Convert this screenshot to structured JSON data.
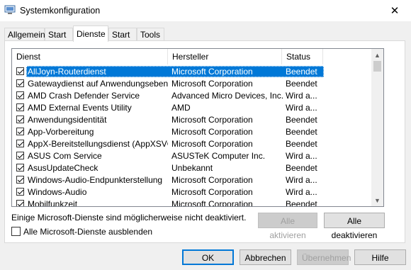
{
  "window": {
    "title": "Systemkonfiguration"
  },
  "tabs": [
    {
      "label": "Allgemein"
    },
    {
      "label": "Start"
    },
    {
      "label": "Dienste"
    },
    {
      "label": "Start"
    },
    {
      "label": "Tools"
    }
  ],
  "table": {
    "columns": [
      "Dienst",
      "Hersteller",
      "Status"
    ],
    "rows": [
      {
        "name": "AllJoyn-Routerdienst",
        "vendor": "Microsoft Corporation",
        "status": "Beendet",
        "checked": true,
        "selected": true
      },
      {
        "name": "Gatewaydienst auf Anwendungsebene",
        "vendor": "Microsoft Corporation",
        "status": "Beendet",
        "checked": true
      },
      {
        "name": "AMD Crash Defender Service",
        "vendor": "Advanced Micro Devices, Inc.",
        "status": "Wird a...",
        "checked": true
      },
      {
        "name": "AMD External Events Utility",
        "vendor": "AMD",
        "status": "Wird a...",
        "checked": true
      },
      {
        "name": "Anwendungsidentität",
        "vendor": "Microsoft Corporation",
        "status": "Beendet",
        "checked": true
      },
      {
        "name": "App-Vorbereitung",
        "vendor": "Microsoft Corporation",
        "status": "Beendet",
        "checked": true
      },
      {
        "name": "AppX-Bereitstellungsdienst (AppXSVC)",
        "vendor": "Microsoft Corporation",
        "status": "Beendet",
        "checked": true
      },
      {
        "name": "ASUS Com Service",
        "vendor": "ASUSTeK Computer Inc.",
        "status": "Wird a...",
        "checked": true
      },
      {
        "name": "AsusUpdateCheck",
        "vendor": "Unbekannt",
        "status": "Beendet",
        "checked": true
      },
      {
        "name": "Windows-Audio-Endpunkterstellung",
        "vendor": "Microsoft Corporation",
        "status": "Wird a...",
        "checked": true
      },
      {
        "name": "Windows-Audio",
        "vendor": "Microsoft Corporation",
        "status": "Wird a...",
        "checked": true
      },
      {
        "name": "Mobilfunkzeit",
        "vendor": "Microsoft Corporation",
        "status": "Beendet",
        "checked": true
      }
    ]
  },
  "note": "Einige Microsoft-Dienste sind möglicherweise nicht deaktiviert.",
  "buttons": {
    "enable_all": "Alle aktivieren",
    "disable_all": "Alle deaktivieren",
    "ok": "OK",
    "cancel": "Abbrechen",
    "apply": "Übernehmen",
    "help": "Hilfe"
  },
  "hide_ms": {
    "label": "Alle Microsoft-Dienste ausblenden",
    "checked": false
  },
  "colors": {
    "selection": "#0078d7"
  }
}
